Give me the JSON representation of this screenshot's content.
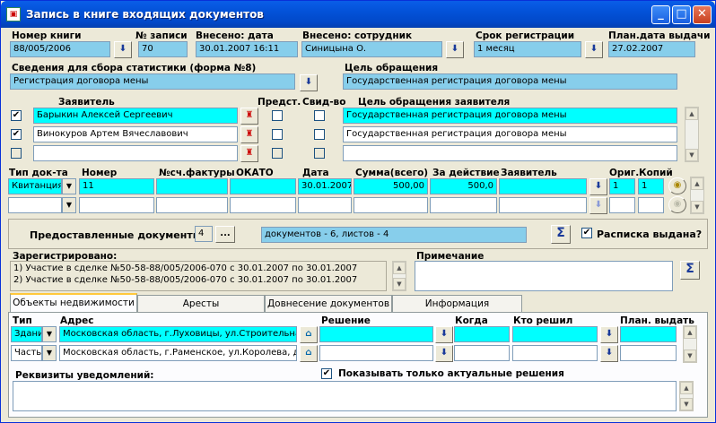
{
  "window": {
    "title": "Запись в книге входящих документов",
    "btn_min": "_",
    "btn_max": "□",
    "btn_close": "✕"
  },
  "colors": {
    "title": "#0352d8",
    "readonly": "#87ceeb",
    "editable": "#00ffff"
  },
  "header": {
    "book_number_label": "Номер книги",
    "book_number": "88/005/2006",
    "record_label": "№ записи",
    "record": "70",
    "entry_date_label": "Внесено: дата",
    "entry_date": "30.01.2007 16:11",
    "employee_label": "Внесено: сотрудник",
    "employee": "Синицына О.",
    "term_label": "Срок регистрации",
    "term": "1 месяц",
    "plan_date_label": "План.дата выдачи",
    "plan_date": "27.02.2007"
  },
  "stats": {
    "label": "Сведения для сбора статистики (форма №8)",
    "value": "Регистрация договора мены"
  },
  "purpose": {
    "label": "Цель обращения",
    "value": "Государственная регистрация договора мены"
  },
  "applicants": {
    "col_applicant": "Заявитель",
    "col_repr": "Предст.",
    "col_cert": "Свид-во",
    "col_purpose": "Цель обращения заявителя",
    "rows": [
      {
        "checked": "✔",
        "name": "Барыкин Алексей Сергеевич",
        "purpose": "Государственная регистрация договора мены"
      },
      {
        "checked": "✔",
        "name": "Винокуров Артем Вячеславович",
        "purpose": "Государственная регистрация договора мены"
      },
      {
        "checked": "",
        "name": "",
        "purpose": ""
      }
    ]
  },
  "docs": {
    "col_type": "Тип док-та",
    "col_number": "Номер",
    "col_invoice": "№сч.фактуры",
    "col_okato": "ОКАТО",
    "col_date": "Дата",
    "col_sum": "Сумма(всего)",
    "col_action": "За действие",
    "col_applicant": "Заявитель",
    "col_orig": "Ориг.",
    "col_copies": "Копий",
    "rows": [
      {
        "type": "Квитанция",
        "number": "11",
        "invoice": "",
        "okato": "",
        "date": "30.01.2007",
        "sum": "500,00",
        "action": "500,0",
        "applicant": "",
        "orig": "1",
        "copies": "1"
      }
    ]
  },
  "provided": {
    "label": "Предоставленные документы:",
    "count": "4",
    "ellipsis": "...",
    "summary": "документов - 6, листов - 4",
    "sigma": "Σ",
    "receipt_label": "Расписка выдана?",
    "receipt_checked": "✔"
  },
  "registered": {
    "label": "Зарегистрировано:",
    "lines": [
      "1) Участие в сделке №50-58-88/005/2006-070 с 30.01.2007 по 30.01.2007",
      "2) Участие в сделке №50-58-88/005/2006-070 с 30.01.2007 по 30.01.2007"
    ]
  },
  "note": {
    "label": "Примечание",
    "value": "",
    "sigma": "Σ"
  },
  "tabs": [
    "Объекты недвижимости",
    "Аресты",
    "Довнесение документов",
    "Информация"
  ],
  "objects": {
    "col_type": "Тип",
    "col_address": "Адрес",
    "col_decision": "Решение",
    "col_when": "Когда",
    "col_who": "Кто решил",
    "col_plan": "План. выдать",
    "rows": [
      {
        "type": "Здани",
        "address": "Московская область, г.Луховицы, ул.Строительна"
      },
      {
        "type": "Часть",
        "address": "Московская область, г.Раменское, ул.Королева, д"
      }
    ]
  },
  "notifications": {
    "label": "Реквизиты уведомлений:",
    "only_actual_label": "Показывать только актуальные решения",
    "only_actual_checked": "✔"
  }
}
